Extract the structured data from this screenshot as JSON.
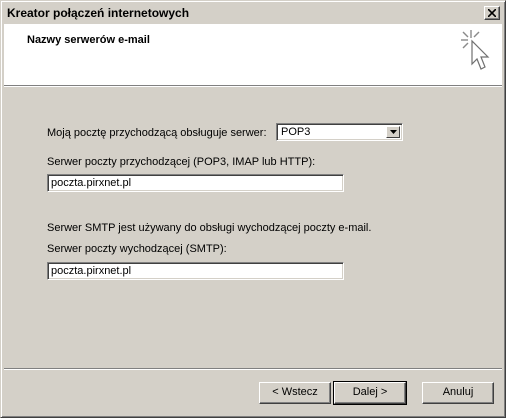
{
  "window": {
    "title": "Kreator połączeń internetowych"
  },
  "header": {
    "title": "Nazwy serwerów e-mail",
    "icon": "wizard-cursor-icon"
  },
  "incoming_type": {
    "label": "Moją pocztę przychodzącą obsługuje serwer:",
    "selected": "POP3"
  },
  "incoming_server": {
    "label": "Serwer poczty przychodzącej (POP3, IMAP lub HTTP):",
    "value": "poczta.pirxnet.pl"
  },
  "smtp_info": {
    "text": "Serwer SMTP jest używany do obsługi wychodzącej poczty e-mail."
  },
  "outgoing_server": {
    "label": "Serwer poczty wychodzącej (SMTP):",
    "value": "poczta.pirxnet.pl"
  },
  "buttons": {
    "back": "< Wstecz",
    "next": "Dalej >",
    "cancel": "Anuluj"
  },
  "colors": {
    "dialog_face": "#d4d0c8",
    "header_bg": "#ffffff"
  }
}
